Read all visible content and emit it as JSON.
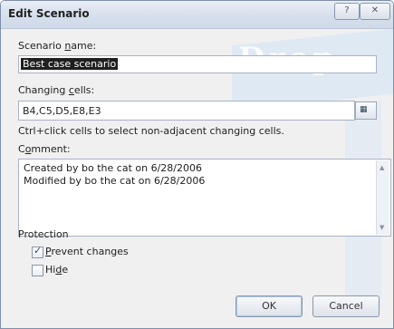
{
  "title": "Edit Scenario",
  "title_buttons": {
    "help": "?",
    "close": "✕"
  },
  "watermark": "Drop",
  "scenario_name": {
    "label_pre": "Scenario ",
    "label_key": "n",
    "label_post": "ame:",
    "value": "Best case scenario"
  },
  "changing_cells": {
    "label_pre": "Changing ",
    "label_key": "c",
    "label_post": "ells:",
    "value": "B4,C5,D5,E8,E3",
    "hint": "Ctrl+click cells to select non-adjacent changing cells.",
    "button_icon": "collapse-dialog-icon"
  },
  "comment": {
    "label_pre": "C",
    "label_key": "o",
    "label_post": "mment:",
    "text": "Created by bo the cat on 6/28/2006\nModified by bo the cat on 6/28/2006"
  },
  "protection": {
    "heading": "Protection",
    "prevent_changes": {
      "key": "P",
      "rest": "revent changes",
      "checked": true
    },
    "hide": {
      "pre": "Hi",
      "key": "d",
      "rest": "e",
      "checked": false
    }
  },
  "buttons": {
    "ok": "OK",
    "cancel": "Cancel"
  }
}
